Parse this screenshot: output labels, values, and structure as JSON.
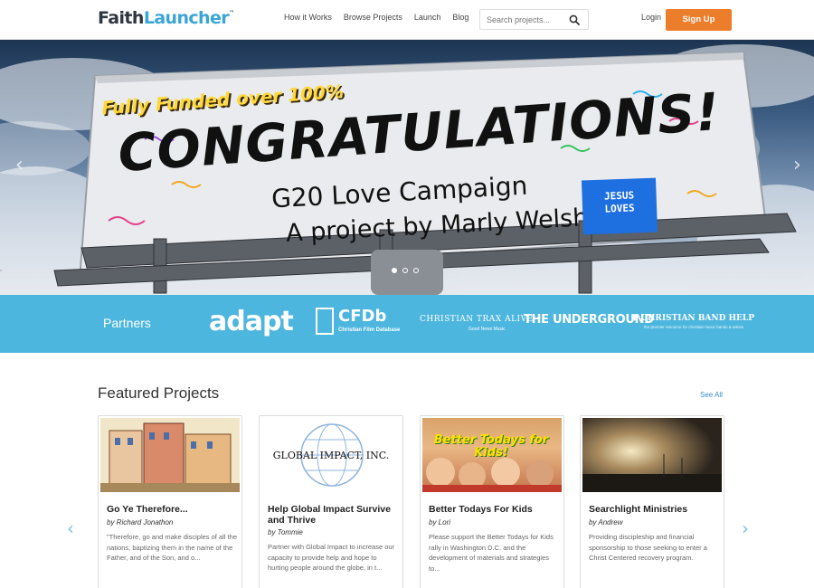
{
  "header": {
    "logo_faith": "Faith",
    "logo_launcher": "Launcher",
    "logo_tm": "™",
    "nav": [
      "How it Works",
      "Browse Projects",
      "Launch",
      "Blog"
    ],
    "search_placeholder": "Search projects...",
    "login": "Login",
    "signup": "Sign Up"
  },
  "hero": {
    "funded_text": "Fully Funded over 100%",
    "congrats_text": "CONGRATULATIONS!",
    "campaign_text": "G20 Love Campaign",
    "byline_text": "A project by Marly Welsh",
    "badge_line1": "JESUS",
    "badge_line2": "LOVES",
    "prev_arrow": "‹",
    "next_arrow": "›",
    "slide_count": 3,
    "active_slide": 1
  },
  "partners": {
    "label": "Partners",
    "adapt": "adapt",
    "cfdb": "CFDb",
    "cfdb_sub": "Christian Film Database",
    "trax": "CHRISTIAN TRAX ALIVE",
    "trax_sub": "Good News Music",
    "underground": "THE UNDERGROUND",
    "band_help": "CHRISTIAN BAND HELP",
    "band_help_sub": "the premier resource for christian music bands & artists"
  },
  "featured": {
    "title": "Featured Projects",
    "see_all": "See All",
    "prev_arrow": "‹",
    "next_arrow": "›",
    "cards": [
      {
        "title": "Go Ye Therefore...",
        "author": "by Richard Jonathon",
        "desc": "\"Therefore, go and make disciples of all the nations, baptizing them in the name of the Father, and of the Son, and o..."
      },
      {
        "title": "Help Global Impact Survive and Thrive",
        "author": "by Tommie",
        "desc": "Partner with Global Impact to increase our capacity to provide help and hope to hurting people around the globe, in t...",
        "thumb_text": "GLOBAL IMPACT, INC."
      },
      {
        "title": "Better Todays For Kids",
        "author": "by Lori",
        "desc": "Please support the Better Todays for Kids rally in Washington D.C. and the development of materials and strategies to...",
        "thumb_text": "Better Todays for Kids!"
      },
      {
        "title": "Searchlight Ministries",
        "author": "by Andrew",
        "desc": "Providing discipleship and financial sponsorship to those seeking to enter a Christ Centered recovery program."
      }
    ]
  },
  "colors": {
    "accent_orange": "#ec7d2a",
    "brand_blue": "#3aa6d6",
    "partners_band": "#4db6de",
    "link_blue": "#3a8fc8"
  }
}
